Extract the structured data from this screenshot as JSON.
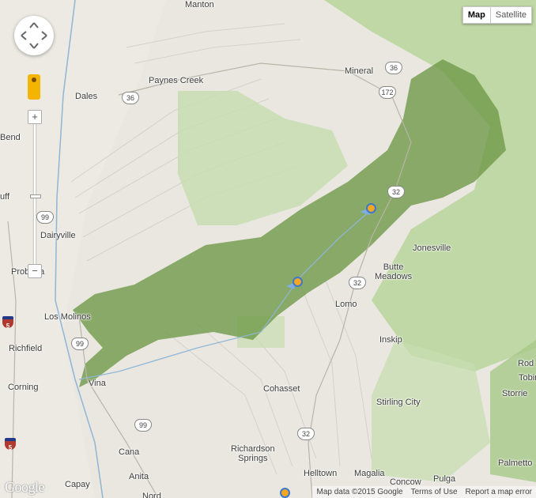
{
  "map_type": {
    "map": "Map",
    "satellite": "Satellite",
    "selected": "Map"
  },
  "places": [
    {
      "id": "manton",
      "name": "Manton"
    },
    {
      "id": "paynes-creek",
      "name": "Paynes Creek"
    },
    {
      "id": "dales",
      "name": "Dales"
    },
    {
      "id": "mineral",
      "name": "Mineral"
    },
    {
      "id": "bend",
      "name": "Bend"
    },
    {
      "id": "bluff",
      "name": "uff"
    },
    {
      "id": "dairyville",
      "name": "Dairyville"
    },
    {
      "id": "proberta",
      "name": "Proberta"
    },
    {
      "id": "los-molinos",
      "name": "Los Molinos"
    },
    {
      "id": "richfield",
      "name": "Richfield"
    },
    {
      "id": "corning",
      "name": "Corning"
    },
    {
      "id": "vina",
      "name": "Vina"
    },
    {
      "id": "jonesville",
      "name": "Jonesville"
    },
    {
      "id": "butte-meadows",
      "name": "Butte\nMeadows"
    },
    {
      "id": "lomo",
      "name": "Lomo"
    },
    {
      "id": "inskip",
      "name": "Inskip"
    },
    {
      "id": "cohasset",
      "name": "Cohasset"
    },
    {
      "id": "stirling-city",
      "name": "Stirling City"
    },
    {
      "id": "richardson-springs",
      "name": "Richardson\nSprings"
    },
    {
      "id": "cana",
      "name": "Cana"
    },
    {
      "id": "anita",
      "name": "Anita"
    },
    {
      "id": "capay",
      "name": "Capay"
    },
    {
      "id": "nord",
      "name": "Nord"
    },
    {
      "id": "magalia",
      "name": "Magalia"
    },
    {
      "id": "concow",
      "name": "Concow"
    },
    {
      "id": "pulga",
      "name": "Pulga"
    },
    {
      "id": "palmetto",
      "name": "Palmetto"
    },
    {
      "id": "rod",
      "name": "Rod"
    },
    {
      "id": "tobin",
      "name": "Tobin"
    },
    {
      "id": "storrie",
      "name": "Storrie"
    },
    {
      "id": "helltown",
      "name": "Helltown"
    }
  ],
  "route_shields": [
    {
      "id": "r36",
      "number": "36"
    },
    {
      "id": "r36b",
      "number": "36"
    },
    {
      "id": "r172",
      "number": "172"
    },
    {
      "id": "r32a",
      "number": "32"
    },
    {
      "id": "r32b",
      "number": "32"
    },
    {
      "id": "r32c",
      "number": "32"
    },
    {
      "id": "r99a",
      "number": "99"
    },
    {
      "id": "r99b",
      "number": "99"
    },
    {
      "id": "r99c",
      "number": "99"
    }
  ],
  "interstate_shields": [
    {
      "id": "i5a",
      "number": "5"
    },
    {
      "id": "i5b",
      "number": "5"
    }
  ],
  "footer": {
    "map_data": "Map data ©2015 Google",
    "terms": "Terms of Use",
    "report": "Report a map error"
  },
  "logo": "Google",
  "colors": {
    "highlight_region": "#6f9a48",
    "forest": "#b9d59b",
    "terrain": "#e8e6df"
  }
}
